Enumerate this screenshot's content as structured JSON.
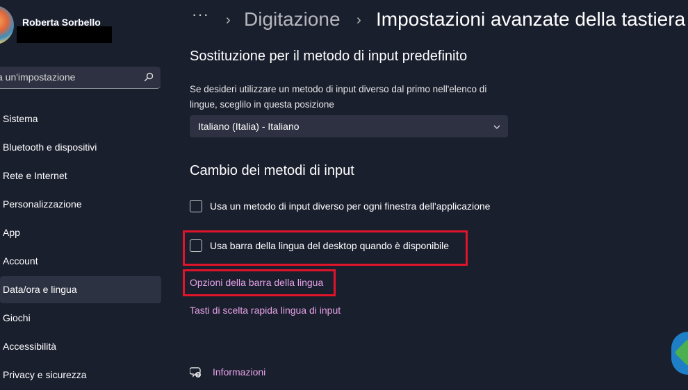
{
  "user": {
    "name": "Roberta Sorbello"
  },
  "search": {
    "placeholder": "a un'impostazione",
    "icon": "search-icon"
  },
  "nav": [
    {
      "label": "Sistema"
    },
    {
      "label": "Bluetooth e dispositivi"
    },
    {
      "label": "Rete e Internet"
    },
    {
      "label": "Personalizzazione"
    },
    {
      "label": "App"
    },
    {
      "label": "Account"
    },
    {
      "label": "Data/ora e lingua",
      "active": true
    },
    {
      "label": "Giochi"
    },
    {
      "label": "Accessibilità"
    },
    {
      "label": "Privacy e sicurezza"
    }
  ],
  "breadcrumb": {
    "more": "···",
    "separator": "›",
    "previous": "Digitazione",
    "current": "Impostazioni avanzate della tastiera"
  },
  "override": {
    "heading": "Sostituzione per il metodo di input predefinito",
    "description": "Se desideri utilizzare un metodo di input diverso dal primo nell'elenco di lingue, sceglilo in questa posizione",
    "selected": "Italiano (Italia) - Italiano"
  },
  "switching": {
    "heading": "Cambio dei metodi di input",
    "checkbox_per_app": "Usa un metodo di input diverso per ogni finestra dell'applicazione",
    "checkbox_language_bar": "Usa barra della lingua del desktop quando è disponibile",
    "link_language_bar_options": "Opzioni della barra della lingua",
    "link_hotkeys": "Tasti di scelta rapida lingua di input"
  },
  "footer": {
    "info_link": "Informazioni"
  },
  "colors": {
    "background": "#1a1f2e",
    "link": "#e7a3e7",
    "highlight": "#e0142a",
    "control": "#2d3141"
  }
}
